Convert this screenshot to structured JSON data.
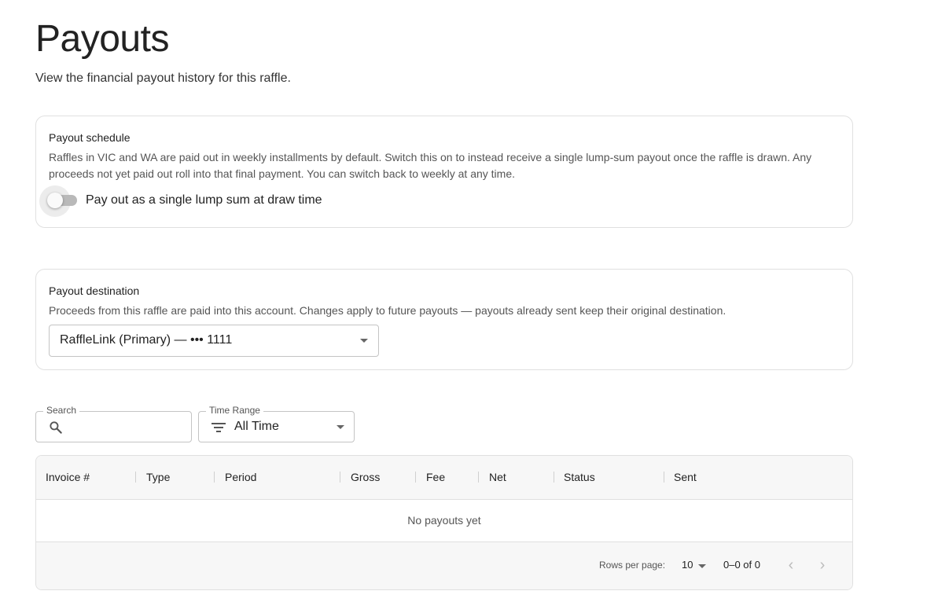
{
  "page": {
    "title": "Payouts",
    "subtitle": "View the financial payout history for this raffle."
  },
  "schedule": {
    "title": "Payout schedule",
    "description": "Raffles in VIC and WA are paid out in weekly installments by default. Switch this on to instead receive a single lump-sum payout once the raffle is drawn. Any proceeds not yet paid out roll into that final payment. You can switch back to weekly at any time.",
    "toggle_label": "Pay out as a single lump sum at draw time",
    "toggle_on": false
  },
  "destination": {
    "title": "Payout destination",
    "description": "Proceeds from this raffle are paid into this account. Changes apply to future payouts — payouts already sent keep their original destination.",
    "selected_account": "RaffleLink (Primary) — ••• 1111"
  },
  "filters": {
    "search_label": "Search",
    "search_value": "",
    "time_range_label": "Time Range",
    "time_range_value": "All Time"
  },
  "table": {
    "columns": [
      "Invoice #",
      "Type",
      "Period",
      "Gross",
      "Fee",
      "Net",
      "Status",
      "Sent"
    ],
    "rows": [],
    "empty_message": "No payouts yet",
    "rows_per_page_label": "Rows per page:",
    "rows_per_page": "10",
    "range": "0–0 of 0"
  },
  "icons": [
    "search-icon",
    "filter-icon",
    "chevron-down-icon",
    "chevron-left-icon",
    "chevron-right-icon"
  ],
  "colors": {
    "border": "#e0e0e0",
    "toggle_track_off": "#b9b9b9",
    "header_bg": "#f7f7f7",
    "disabled_icon": "#bcbcbc"
  }
}
